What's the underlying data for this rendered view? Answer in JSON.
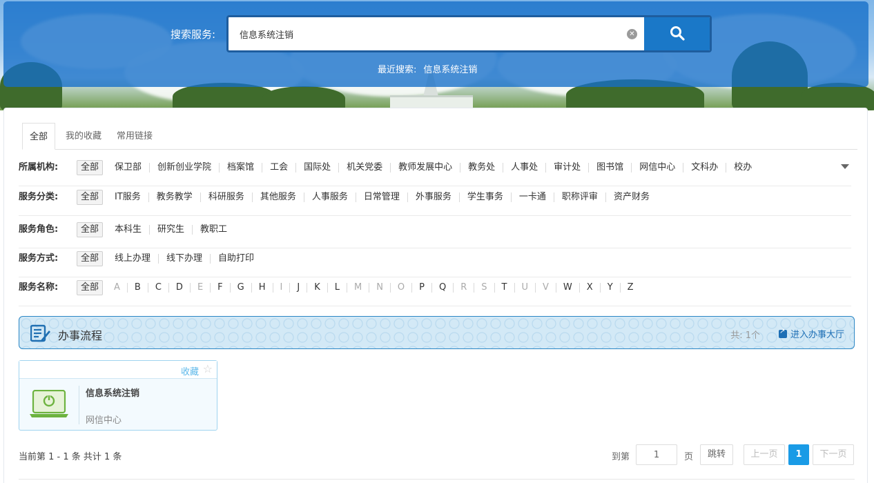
{
  "search": {
    "label": "搜索服务:",
    "value": "信息系统注销",
    "recent_label": "最近搜索:",
    "recent_item": "信息系统注销"
  },
  "tabs": [
    {
      "label": "全部"
    },
    {
      "label": "我的收藏"
    },
    {
      "label": "常用链接"
    }
  ],
  "filters": {
    "org": {
      "label": "所属机构:",
      "options": [
        "全部",
        "保卫部",
        "创新创业学院",
        "档案馆",
        "工会",
        "国际处",
        "机关党委",
        "教师发展中心",
        "教务处",
        "人事处",
        "审计处",
        "图书馆",
        "网信中心",
        "文科办",
        "校办"
      ]
    },
    "category": {
      "label": "服务分类:",
      "options": [
        "全部",
        "IT服务",
        "教务教学",
        "科研服务",
        "其他服务",
        "人事服务",
        "日常管理",
        "外事服务",
        "学生事务",
        "一卡通",
        "职称评审",
        "资产财务"
      ]
    },
    "role": {
      "label": "服务角色:",
      "options": [
        "全部",
        "本科生",
        "研究生",
        "教职工"
      ]
    },
    "mode": {
      "label": "服务方式:",
      "options": [
        "全部",
        "线上办理",
        "线下办理",
        "自助打印"
      ]
    },
    "name": {
      "label": "服务名称:",
      "options": [
        "全部",
        "A",
        "B",
        "C",
        "D",
        "E",
        "F",
        "G",
        "H",
        "I",
        "J",
        "K",
        "L",
        "M",
        "N",
        "O",
        "P",
        "Q",
        "R",
        "S",
        "T",
        "U",
        "V",
        "W",
        "X",
        "Y",
        "Z"
      ],
      "dim": [
        "A",
        "E",
        "I",
        "M",
        "N",
        "O",
        "R",
        "S",
        "U",
        "V"
      ]
    }
  },
  "section": {
    "title": "办事流程",
    "count": "共: 1个",
    "hall_link": "进入办事大厅"
  },
  "service": {
    "fav_label": "收藏",
    "name": "信息系统注销",
    "dept": "网信中心"
  },
  "pager": {
    "info": "当前第 1 - 1 条 共计 1 条",
    "goto_label": "到第",
    "goto_value": "1",
    "page_label": "页",
    "jump": "跳转",
    "prev": "上一页",
    "current": "1",
    "next": "下一页"
  },
  "colors": {
    "primary": "#1a78c8",
    "accent": "#1a9be6",
    "link": "#1e6fb5"
  }
}
